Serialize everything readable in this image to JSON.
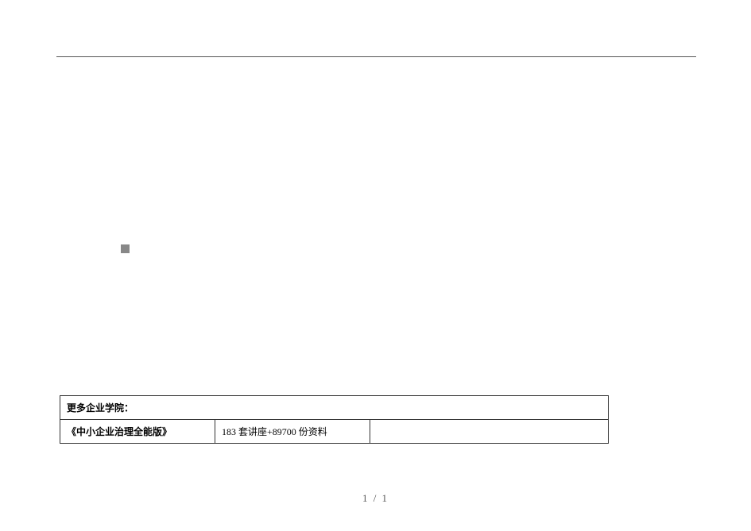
{
  "bullet": "■",
  "table": {
    "header": "更多企业学院：",
    "row": {
      "title": "《中小企业治理全能版》",
      "detail": "183 套讲座+89700 份资料",
      "extra": ""
    }
  },
  "page_number": "1 / 1"
}
